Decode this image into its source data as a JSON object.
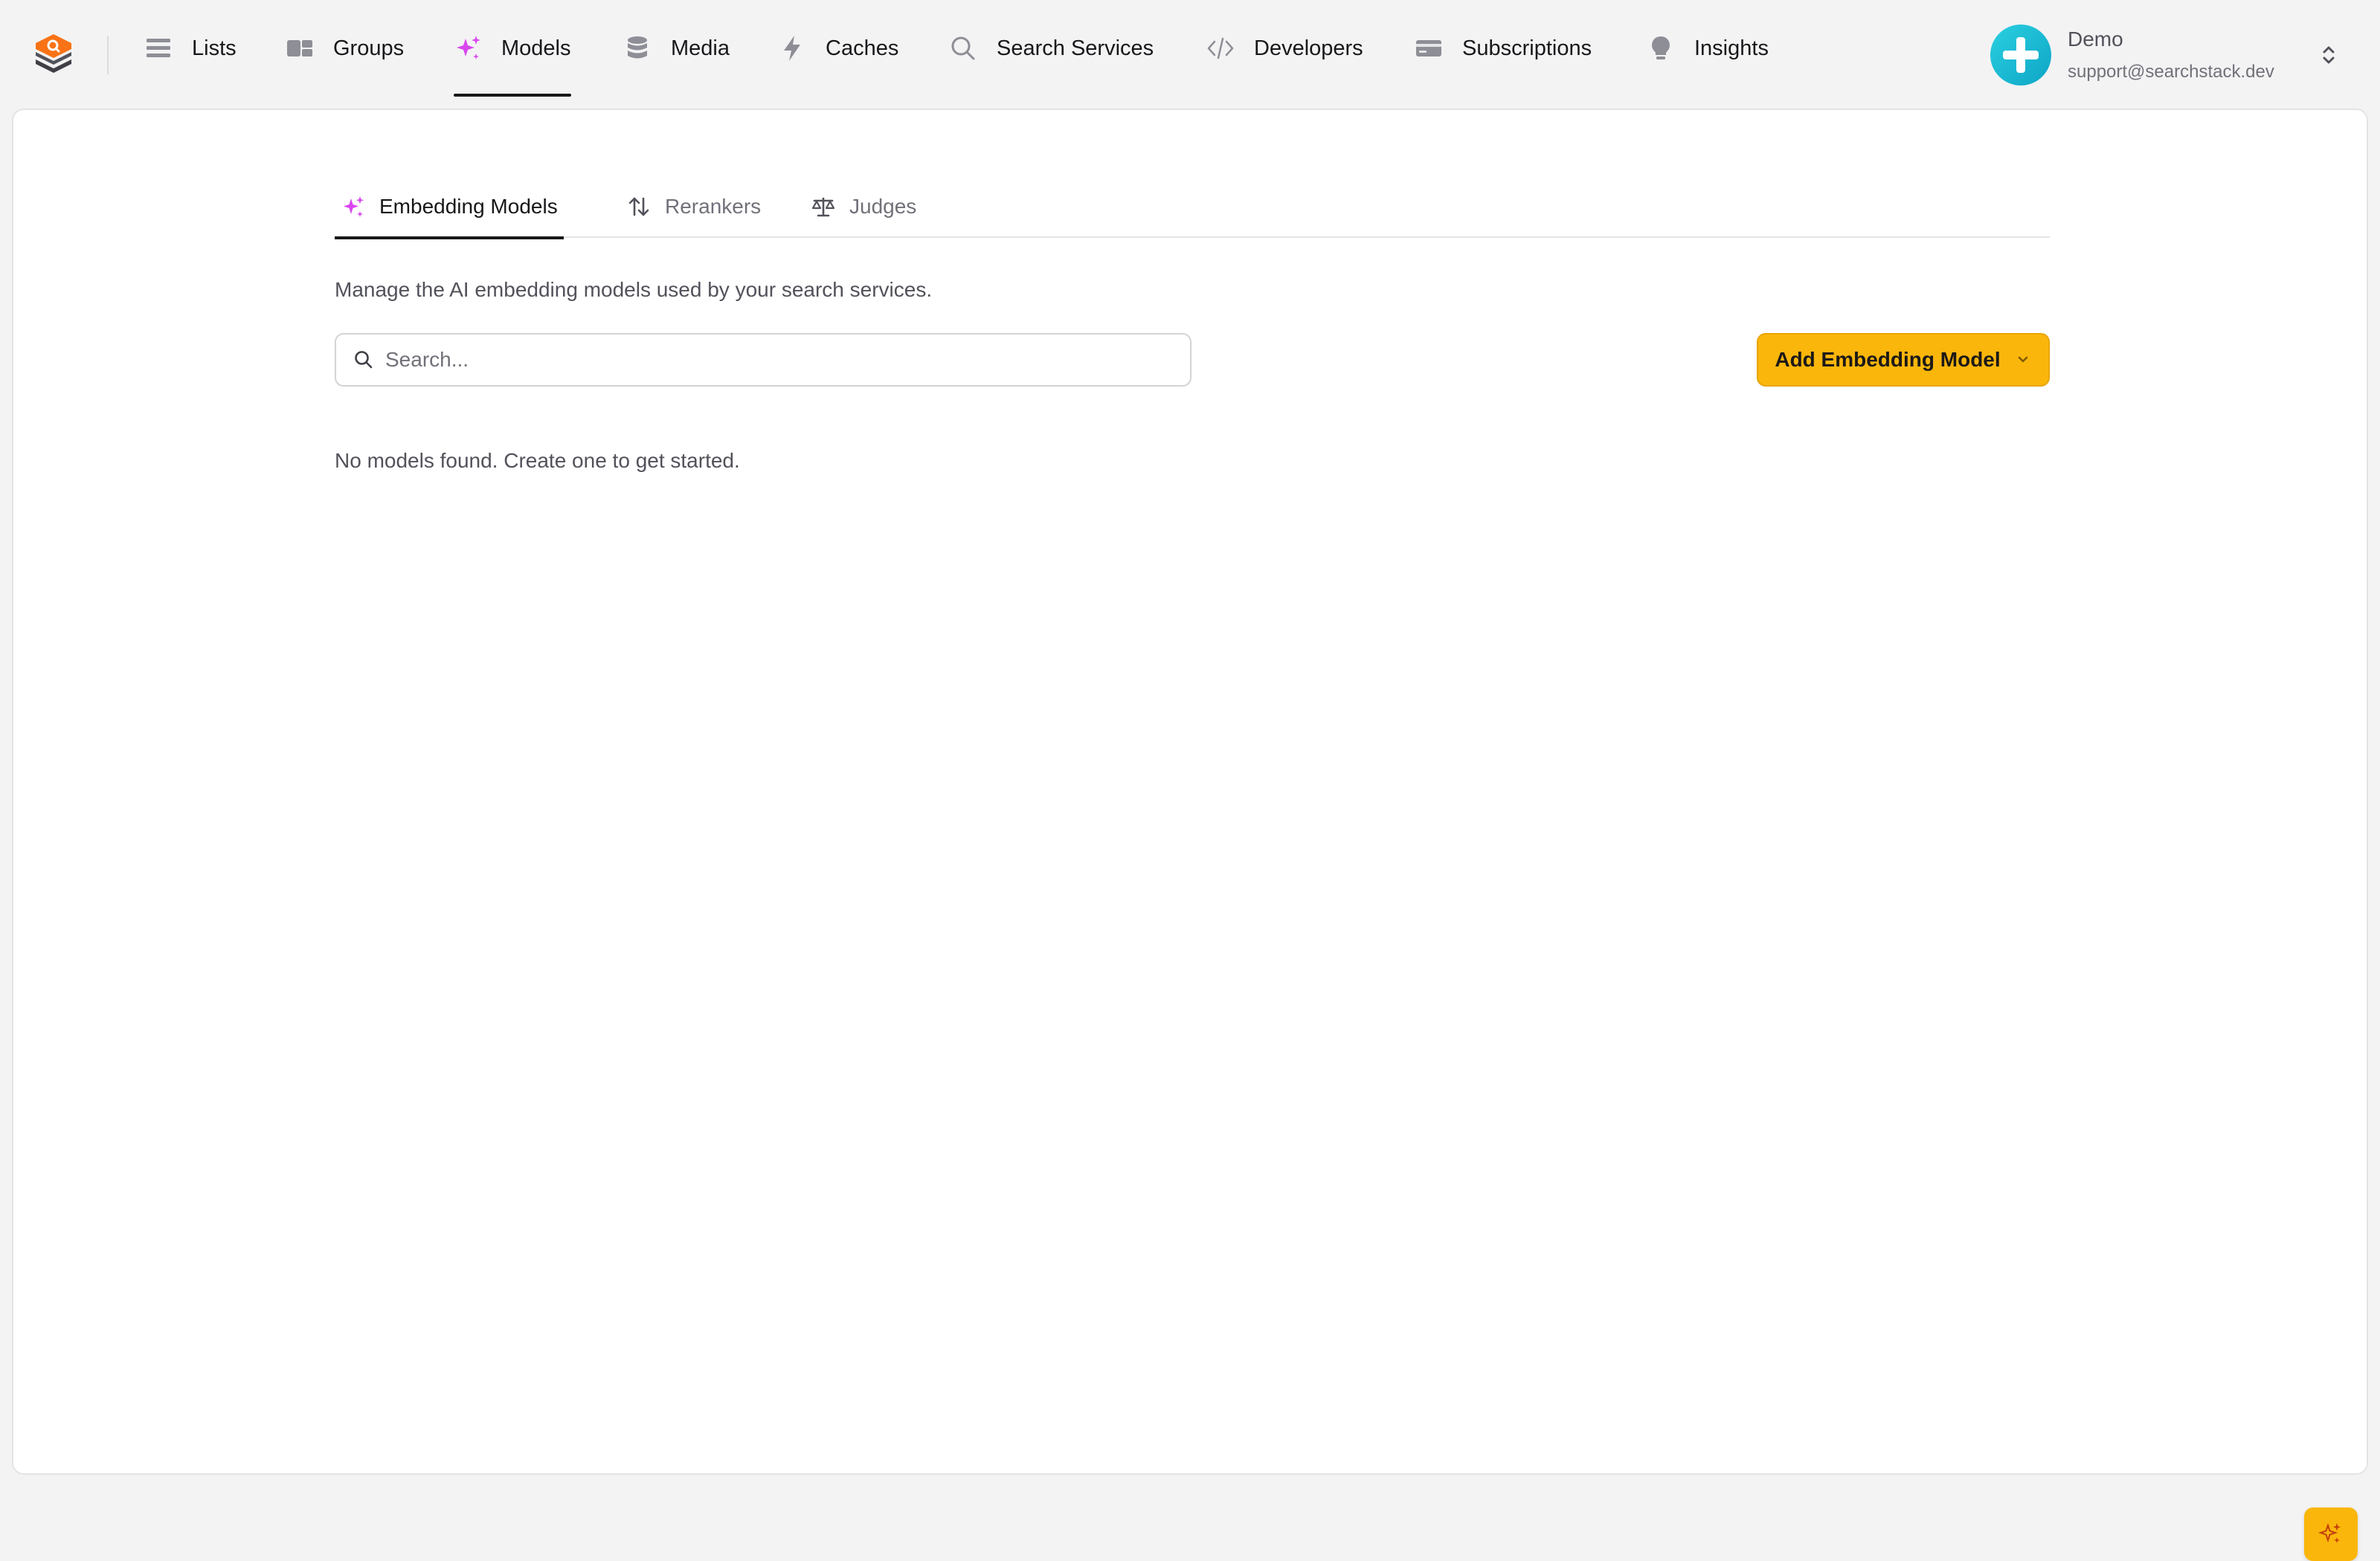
{
  "nav": {
    "items": [
      {
        "label": "Lists",
        "icon": "list-icon"
      },
      {
        "label": "Groups",
        "icon": "groups-icon"
      },
      {
        "label": "Models",
        "icon": "sparkles-icon",
        "active": true
      },
      {
        "label": "Media",
        "icon": "database-icon"
      },
      {
        "label": "Caches",
        "icon": "lightning-icon"
      },
      {
        "label": "Search Services",
        "icon": "search-icon"
      },
      {
        "label": "Developers",
        "icon": "code-icon"
      },
      {
        "label": "Subscriptions",
        "icon": "credit-card-icon"
      },
      {
        "label": "Insights",
        "icon": "lightbulb-icon"
      }
    ]
  },
  "account": {
    "name": "Demo",
    "email": "support@searchstack.dev"
  },
  "tabs": [
    {
      "label": "Embedding Models",
      "icon": "sparkles-icon",
      "active": true
    },
    {
      "label": "Rerankers",
      "icon": "arrows-up-down-icon"
    },
    {
      "label": "Judges",
      "icon": "scale-icon"
    }
  ],
  "main": {
    "description": "Manage the AI embedding models used by your search services.",
    "search_placeholder": "Search...",
    "add_button_label": "Add Embedding Model",
    "empty_message": "No models found. Create one to get started."
  },
  "colors": {
    "accent": "#fbb60b",
    "models_icon": "#d946ef",
    "avatar": "#0ea5c6"
  }
}
